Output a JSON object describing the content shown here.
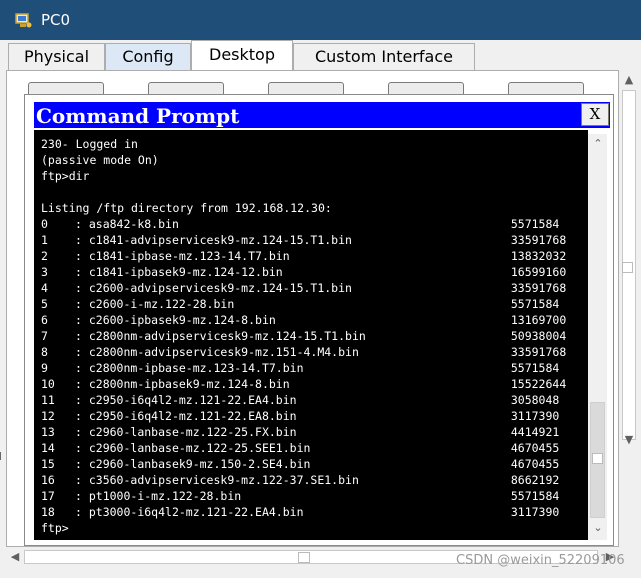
{
  "window": {
    "title": "PC0",
    "icon": "packet-tracer-pc-icon"
  },
  "tabs": [
    {
      "label": "Physical",
      "state": "normal"
    },
    {
      "label": "Config",
      "state": "hover"
    },
    {
      "label": "Desktop",
      "state": "active"
    },
    {
      "label": "Custom Interface",
      "state": "normal"
    }
  ],
  "command_prompt": {
    "title": "Command Prompt",
    "close_label": "X",
    "lines": [
      "230- Logged in",
      "(passive mode On)",
      "ftp>dir",
      "",
      "Listing /ftp directory from 192.168.12.30:"
    ],
    "files": [
      {
        "index": "0",
        "name": "asa842-k8.bin",
        "size": "5571584"
      },
      {
        "index": "1",
        "name": "c1841-advipservicesk9-mz.124-15.T1.bin",
        "size": "33591768"
      },
      {
        "index": "2",
        "name": "c1841-ipbase-mz.123-14.T7.bin",
        "size": "13832032"
      },
      {
        "index": "3",
        "name": "c1841-ipbasek9-mz.124-12.bin",
        "size": "16599160"
      },
      {
        "index": "4",
        "name": "c2600-advipservicesk9-mz.124-15.T1.bin",
        "size": "33591768"
      },
      {
        "index": "5",
        "name": "c2600-i-mz.122-28.bin",
        "size": "5571584"
      },
      {
        "index": "6",
        "name": "c2600-ipbasek9-mz.124-8.bin",
        "size": "13169700"
      },
      {
        "index": "7",
        "name": "c2800nm-advipservicesk9-mz.124-15.T1.bin",
        "size": "50938004"
      },
      {
        "index": "8",
        "name": "c2800nm-advipservicesk9-mz.151-4.M4.bin",
        "size": "33591768"
      },
      {
        "index": "9",
        "name": "c2800nm-ipbase-mz.123-14.T7.bin",
        "size": "5571584"
      },
      {
        "index": "10",
        "name": "c2800nm-ipbasek9-mz.124-8.bin",
        "size": "15522644"
      },
      {
        "index": "11",
        "name": "c2950-i6q4l2-mz.121-22.EA4.bin",
        "size": "3058048"
      },
      {
        "index": "12",
        "name": "c2950-i6q4l2-mz.121-22.EA8.bin",
        "size": "3117390"
      },
      {
        "index": "13",
        "name": "c2960-lanbase-mz.122-25.FX.bin",
        "size": "4414921"
      },
      {
        "index": "14",
        "name": "c2960-lanbase-mz.122-25.SEE1.bin",
        "size": "4670455"
      },
      {
        "index": "15",
        "name": "c2960-lanbasek9-mz.150-2.SE4.bin",
        "size": "4670455"
      },
      {
        "index": "16",
        "name": "c3560-advipservicesk9-mz.122-37.SE1.bin",
        "size": "8662192"
      },
      {
        "index": "17",
        "name": "pt1000-i-mz.122-28.bin",
        "size": "5571584"
      },
      {
        "index": "18",
        "name": "pt3000-i6q4l2-mz.121-22.EA4.bin",
        "size": "3117390"
      }
    ],
    "prompt": "ftp>"
  },
  "watermark": "CSDN @weixin_52209106",
  "colors": {
    "titlebar": "#1f4e78",
    "cmd_titlebar": "#0000ff",
    "terminal_bg": "#000000",
    "terminal_text": "#ffffff"
  }
}
